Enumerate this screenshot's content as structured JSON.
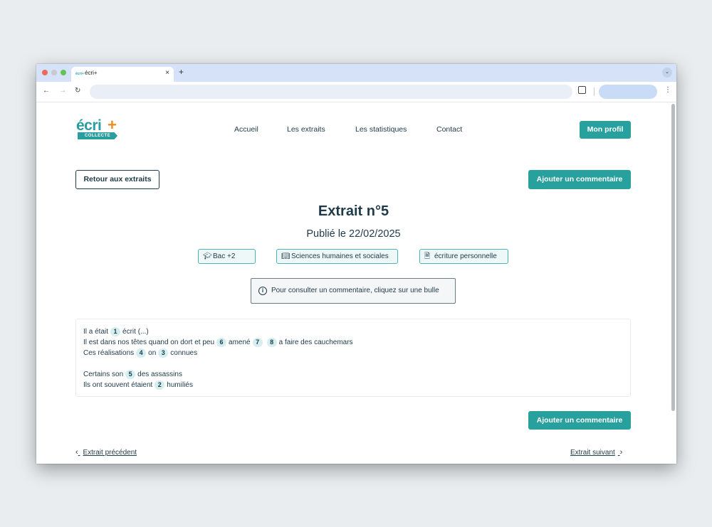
{
  "browser": {
    "tab_title": "écri+",
    "tab_favicon": "écri+",
    "close_glyph": "×",
    "new_tab_glyph": "+",
    "menu_glyph": "⌄",
    "back_glyph": "←",
    "forward_glyph": "→",
    "reload_glyph": "↻",
    "kebab_glyph": "⋮",
    "traffic_lights": [
      "#ed6a5e",
      "#c7c9cc",
      "#61c554"
    ]
  },
  "site": {
    "logo_text": "écri",
    "logo_plus": "+",
    "logo_tag": "COLLECTE",
    "nav": [
      "Accueil",
      "Les extraits",
      "Les statistiques",
      "Contact"
    ],
    "profile_button": "Mon profil"
  },
  "page": {
    "back_button": "Retour aux extraits",
    "add_comment_button": "Ajouter un commentaire",
    "title": "Extrait n°5",
    "published": "Publié le 22/02/2025",
    "chips": [
      {
        "icon": "graduation-cap-icon",
        "label": "Bac +2"
      },
      {
        "icon": "book-icon",
        "label": "Sciences humaines et sociales"
      },
      {
        "icon": "document-icon",
        "label": "écriture personnelle"
      }
    ],
    "info": "Pour consulter un commentaire, cliquez sur une bulle",
    "extract_lines": [
      [
        {
          "t": "Il a était"
        },
        {
          "b": "1"
        },
        {
          "t": "écrit (...)"
        }
      ],
      [
        {
          "t": "Il est dans nos têtes quand on dort et peu"
        },
        {
          "b": "6"
        },
        {
          "t": "amené"
        },
        {
          "b": "7"
        },
        {
          "b": "8"
        },
        {
          "t": "a faire des cauchemars"
        }
      ],
      [
        {
          "t": "Ces réalisations"
        },
        {
          "b": "4"
        },
        {
          "t": "on"
        },
        {
          "b": "3"
        },
        {
          "t": "connues"
        }
      ],
      [
        {
          "t": "Certains son"
        },
        {
          "b": "5"
        },
        {
          "t": "des assassins"
        }
      ],
      [
        {
          "t": "Ils ont souvent étaient"
        },
        {
          "b": "2"
        },
        {
          "t": "humiliés"
        }
      ]
    ],
    "prev_link": "Extrait précédent",
    "next_link": "Extrait suivant",
    "prev_glyph": "‹",
    "next_glyph": "›"
  },
  "colors": {
    "accent": "#28a09e",
    "text": "#1f3a48",
    "logo_plus": "#f08c1f"
  }
}
